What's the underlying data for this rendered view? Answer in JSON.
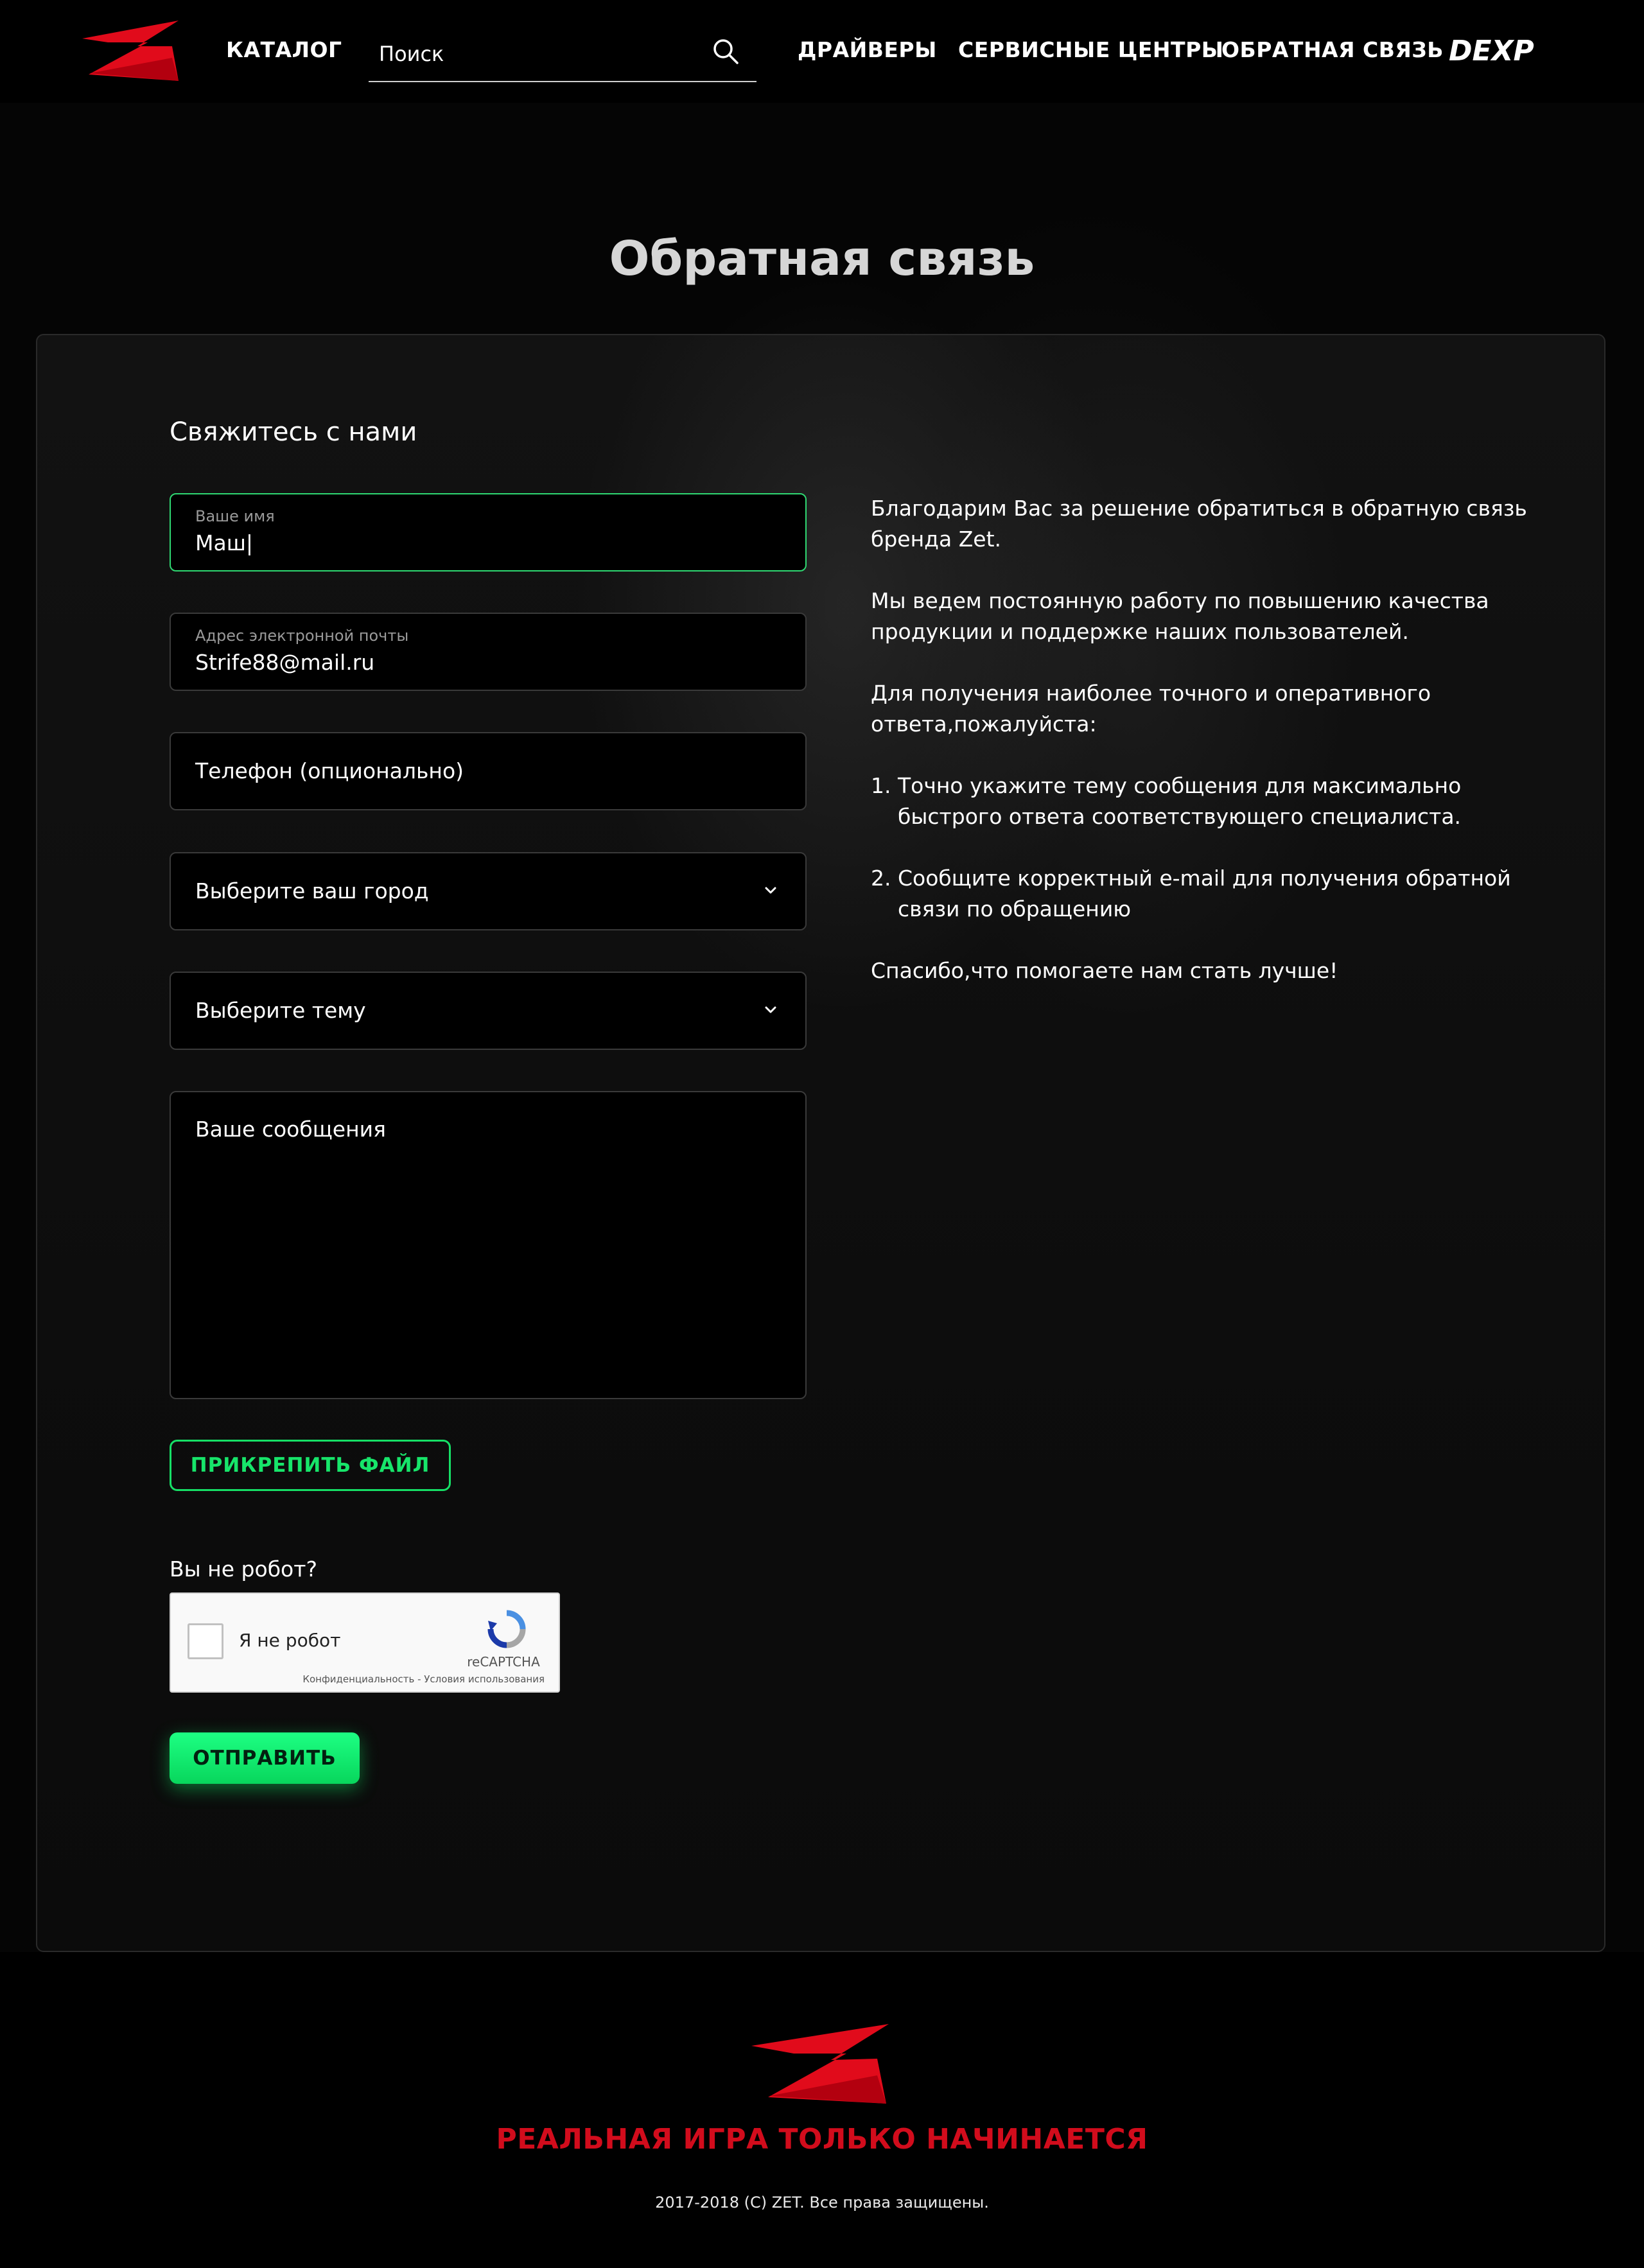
{
  "header": {
    "catalog": "КАТАЛОГ",
    "search_placeholder": "Поиск",
    "nav": [
      "ДРАЙВЕРЫ",
      "СЕРВИСНЫЕ ЦЕНТРЫ",
      "ОБРАТНАЯ СВЯЗЬ"
    ],
    "brand_logo": "DEXP"
  },
  "page": {
    "title": "Обратная связь"
  },
  "form": {
    "section_title": "Свяжитесь с нами",
    "name_label": "Ваше имя",
    "name_value": "Маш|",
    "email_label": "Адрес электронной почты",
    "email_value": "Strife88@mail.ru",
    "phone_placeholder": "Телефон (опционально)",
    "city_placeholder": "Выберите ваш город",
    "topic_placeholder": "Выберите тему",
    "message_placeholder": "Ваше сообщения",
    "attach_label": "ПРИКРЕПИТЬ ФАЙЛ",
    "robot_question": "Вы не робот?",
    "captcha_label": "Я не робот",
    "captcha_brand": "reCAPTCHA",
    "captcha_terms": "Конфиденциальность - Условия использования",
    "submit_label": "ОТПРАВИТЬ"
  },
  "info": {
    "p1": "Благодарим Вас за решение обратиться в обратную связь бренда Zet.",
    "p2": "Мы ведем постоянную работу по повышению качества продукции и поддержке наших пользователей.",
    "p3": "Для получения наиболее точного и оперативного ответа,пожалуйста:",
    "item1": "1. Точно укажите тему сообщения для максимально быстрого ответа соответствующего специалиста.",
    "item2": "2. Сообщите корректный e-mail для получения обратной связи по обращению",
    "p4": "Спасибо,что помогаете нам стать лучше!"
  },
  "footer": {
    "tagline": "РЕАЛЬНАЯ ИГРА ТОЛЬКО НАЧИНАЕТСЯ",
    "copyright": "2017-2018 (C) ZET. Все права защищены."
  },
  "colors": {
    "accent_green": "#16e066",
    "brand_red": "#d20c1c",
    "background": "#000000"
  },
  "icons": [
    "zet-logo-icon",
    "search-icon",
    "dexp-logo-icon",
    "chevron-down-icon",
    "recaptcha-icon"
  ]
}
